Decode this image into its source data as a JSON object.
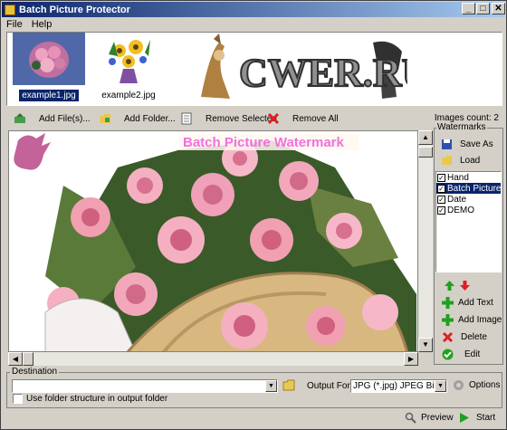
{
  "window": {
    "title": "Batch Picture Protector",
    "min": "_",
    "max": "□",
    "close": "✕"
  },
  "menu": [
    "File",
    "Help"
  ],
  "thumbnails": [
    {
      "caption": "example1.jpg",
      "selected": true
    },
    {
      "caption": "example2.jpg",
      "selected": false
    }
  ],
  "logo_text": "CWER.RU",
  "toolbar": {
    "add_files": "Add File(s)...",
    "add_folder": "Add Folder...",
    "remove_selected": "Remove Selected",
    "remove_all": "Remove All",
    "images_count": "Images count: 2"
  },
  "preview": {
    "watermark_text": "Batch Picture Watermark"
  },
  "watermarks": {
    "legend": "Watermarks",
    "save_as": "Save As",
    "load": "Load",
    "items": [
      {
        "label": "Hand",
        "checked": true,
        "selected": false
      },
      {
        "label": "Batch Picture W",
        "checked": true,
        "selected": true
      },
      {
        "label": "Date",
        "checked": true,
        "selected": false
      },
      {
        "label": "DEMO",
        "checked": true,
        "selected": false
      }
    ],
    "add_text": "Add Text",
    "add_image": "Add Image",
    "delete": "Delete",
    "edit": "Edit"
  },
  "destination": {
    "legend": "Destination",
    "path_value": "",
    "output_format_label": "Output Format",
    "output_format_value": "JPG (*.jpg) JPEG Bitmap",
    "options": "Options",
    "use_folder_structure": "Use folder structure in output folder"
  },
  "footer": {
    "preview": "Preview",
    "start": "Start"
  },
  "colors": {
    "title_start": "#0a246a",
    "title_end": "#a6caf0",
    "watermark_pink": "#f070e0",
    "selection": "#0a246a"
  }
}
